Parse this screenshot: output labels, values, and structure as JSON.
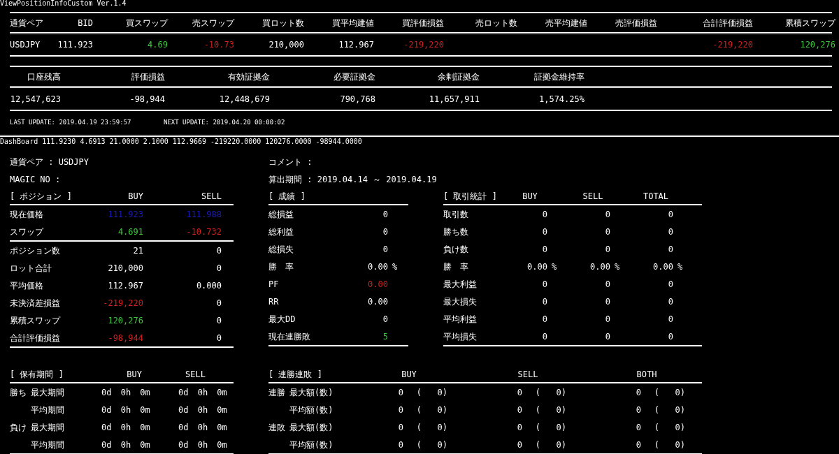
{
  "indicator_title": "ViewPositionInfoCustom Ver.1.4",
  "positions_table": {
    "columns": [
      "通貨ペア",
      "BID",
      "買スワップ",
      "売スワップ",
      "買ロット数",
      "買平均建値",
      "買評価損益",
      "売ロット数",
      "売平均建値",
      "売評価損益",
      "合計評価損益",
      "累積スワップ"
    ],
    "rows": [
      {
        "cells": [
          "USDJPY",
          "111.923",
          {
            "text": "4.69",
            "color": "#3cc83c"
          },
          {
            "text": "-10.73",
            "color": "#d22020"
          },
          "210,000",
          "112.967",
          {
            "text": "-219,220",
            "color": "#d22020"
          },
          null,
          null,
          null,
          {
            "text": "-219,220",
            "color": "#d22020"
          },
          {
            "text": "120,276",
            "color": "#3cc83c"
          }
        ]
      }
    ]
  },
  "account_table": {
    "columns": [
      "口座残高",
      "評価損益",
      "有効証拠金",
      "必要証拠金",
      "余剰証拠金",
      "証拠金維持率"
    ],
    "values": [
      "12,547,623",
      "-98,944",
      "12,448,679",
      "790,768",
      "11,657,911",
      "1,574.25%"
    ]
  },
  "last_update": "LAST UPDATE: 2019.04.19 23:59:57",
  "next_update": "NEXT UPDATE: 2019.04.20 00:00:02",
  "dashboard_line": "DashBoard 111.9230 4.6913 21.0000 2.1000 112.9669 -219220.0000 120276.0000 -98944.0000",
  "currency_pair": "通貨ペア : USDJPY",
  "magic_no": "MAGIC NO :",
  "comment": "コメント :",
  "period": "算出期間 : 2019.04.14 ～ 2019.04.19",
  "position": {
    "title": "[ ポジション ]",
    "columns": [
      "BUY",
      "SELL"
    ],
    "price_rows": [
      {
        "label": "現在価格",
        "buy": {
          "text": "111.923",
          "color": "#1c1cb4"
        },
        "sell": {
          "text": "111.988",
          "color": "#1c1cb4"
        }
      },
      {
        "label": "スワップ",
        "buy": {
          "text": "4.691",
          "color": "#3cc83c"
        },
        "sell": {
          "text": "-10.732",
          "color": "#d22020"
        }
      }
    ],
    "rows": [
      {
        "label": "ポジション数",
        "buy": "21",
        "sell": "0"
      },
      {
        "label": "ロット合計",
        "buy": "210,000",
        "sell": "0"
      },
      {
        "label": "平均価格",
        "buy": "112.967",
        "sell": "0.000"
      },
      {
        "label": "未決済差損益",
        "buy": {
          "text": "-219,220",
          "color": "#d22020"
        },
        "sell": "0"
      },
      {
        "label": "累積スワップ",
        "buy": {
          "text": "120,276",
          "color": "#3cc83c"
        },
        "sell": "0"
      },
      {
        "label": "合計評価損益",
        "buy": {
          "text": "-98,944",
          "color": "#d22020"
        },
        "sell": "0"
      }
    ]
  },
  "results": {
    "title": "[ 成績 ]",
    "rows": [
      {
        "label": "総損益",
        "value": "0"
      },
      {
        "label": "総利益",
        "value": "0"
      },
      {
        "label": "総損失",
        "value": "0"
      },
      {
        "label": "勝　率",
        "value": "0.00",
        "unit": "%"
      },
      {
        "label": "PF",
        "value": {
          "text": "0.00",
          "color": "#d22020"
        }
      },
      {
        "label": "RR",
        "value": "0.00"
      },
      {
        "label": "最大DD",
        "value": "0"
      },
      {
        "label": "現在連勝敗",
        "value": {
          "text": "5",
          "color": "#3cc83c"
        }
      }
    ]
  },
  "trade_stats": {
    "title": "[ 取引統計 ]",
    "columns": [
      "BUY",
      "SELL",
      "TOTAL"
    ],
    "rows": [
      {
        "label": "取引数",
        "values": [
          {
            "value": "0"
          },
          {
            "value": "0"
          },
          {
            "value": "0"
          }
        ]
      },
      {
        "label": "勝ち数",
        "values": [
          {
            "value": "0"
          },
          {
            "value": "0"
          },
          {
            "value": "0"
          }
        ]
      },
      {
        "label": "負け数",
        "values": [
          {
            "value": "0"
          },
          {
            "value": "0"
          },
          {
            "value": "0"
          }
        ]
      },
      {
        "label": "勝　率",
        "values": [
          {
            "value": "0.00",
            "unit": "%"
          },
          {
            "value": "0.00",
            "unit": "%"
          },
          {
            "value": "0.00",
            "unit": "%"
          }
        ]
      },
      {
        "label": "最大利益",
        "values": [
          {
            "value": "0"
          },
          {
            "value": "0"
          },
          {
            "value": "0"
          }
        ]
      },
      {
        "label": "最大損失",
        "values": [
          {
            "value": "0"
          },
          {
            "value": "0"
          },
          {
            "value": "0"
          }
        ]
      },
      {
        "label": "平均利益",
        "values": [
          {
            "value": "0"
          },
          {
            "value": "0"
          },
          {
            "value": "0"
          }
        ]
      },
      {
        "label": "平均損失",
        "values": [
          {
            "value": "0"
          },
          {
            "value": "0"
          },
          {
            "value": "0"
          }
        ]
      }
    ]
  },
  "holding_period": {
    "title": "[ 保有期間 ]",
    "columns": [
      "BUY",
      "SELL"
    ],
    "rows": [
      {
        "group": "勝ち",
        "label": "最大期間",
        "values": [
          "0d 0h 0m",
          "0d 0h 0m"
        ]
      },
      {
        "label": "平均期間",
        "values": [
          "0d 0h 0m",
          "0d 0h 0m"
        ]
      },
      {
        "group": "負け",
        "label": "最大期間",
        "values": [
          "0d 0h 0m",
          "0d 0h 0m"
        ]
      },
      {
        "label": "平均期間",
        "values": [
          "0d 0h 0m",
          "0d 0h 0m"
        ]
      }
    ]
  },
  "streaks": {
    "title": "[ 連勝連敗 ]",
    "columns": [
      "BUY",
      "SELL",
      "BOTH"
    ],
    "rows": [
      {
        "group": "連勝",
        "label": "最大額(数)",
        "values": [
          [
            "0",
            "(",
            "0)"
          ],
          [
            "0",
            "(",
            "0)"
          ],
          [
            "0",
            "(",
            "0)"
          ]
        ]
      },
      {
        "label": "平均額(数)",
        "values": [
          [
            "0",
            "(",
            "0)"
          ],
          [
            "0",
            "(",
            "0)"
          ],
          [
            "0",
            "(",
            "0)"
          ]
        ]
      },
      {
        "group": "連敗",
        "label": "最大額(数)",
        "values": [
          [
            "0",
            "(",
            "0)"
          ],
          [
            "0",
            "(",
            "0)"
          ],
          [
            "0",
            "(",
            "0)"
          ]
        ]
      },
      {
        "label": "平均額(数)",
        "values": [
          [
            "0",
            "(",
            "0)"
          ],
          [
            "0",
            "(",
            "0)"
          ],
          [
            "0",
            "(",
            "0)"
          ]
        ]
      }
    ]
  }
}
